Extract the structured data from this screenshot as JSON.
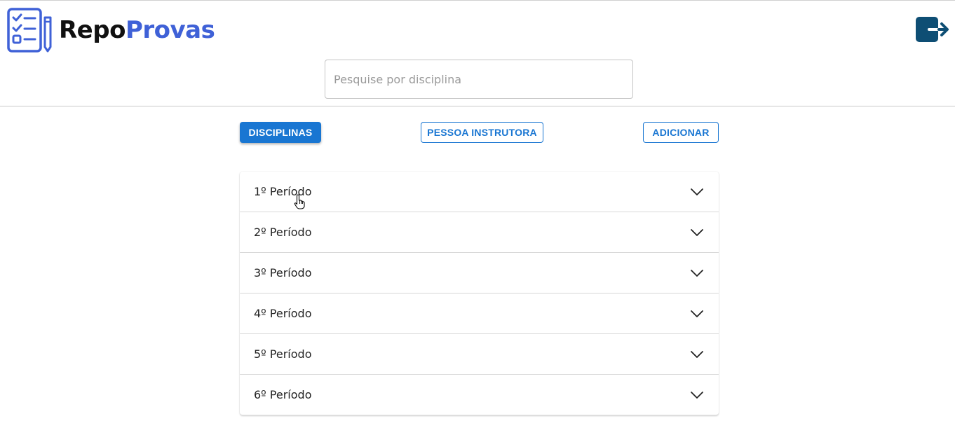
{
  "brand": {
    "part1": "Repo",
    "part2": "Provas"
  },
  "colors": {
    "brand_blue": "#3f61d7",
    "primary": "#1976d2",
    "logout_bg": "#0e4e74"
  },
  "search": {
    "placeholder": "Pesquise por disciplina",
    "value": ""
  },
  "toolbar": {
    "disciplinas_label": "DISCIPLINAS",
    "instrutora_label": "PESSOA INSTRUTORA",
    "adicionar_label": "ADICIONAR"
  },
  "periods": [
    {
      "label": "1º Período"
    },
    {
      "label": "2º Período"
    },
    {
      "label": "3º Período"
    },
    {
      "label": "4º Período"
    },
    {
      "label": "5º Período"
    },
    {
      "label": "6º Período"
    }
  ],
  "icons": {
    "logo": "checklist-pencil-icon",
    "logout": "logout-icon",
    "expand": "chevron-down-icon",
    "cursor": "hand-pointer-icon"
  }
}
